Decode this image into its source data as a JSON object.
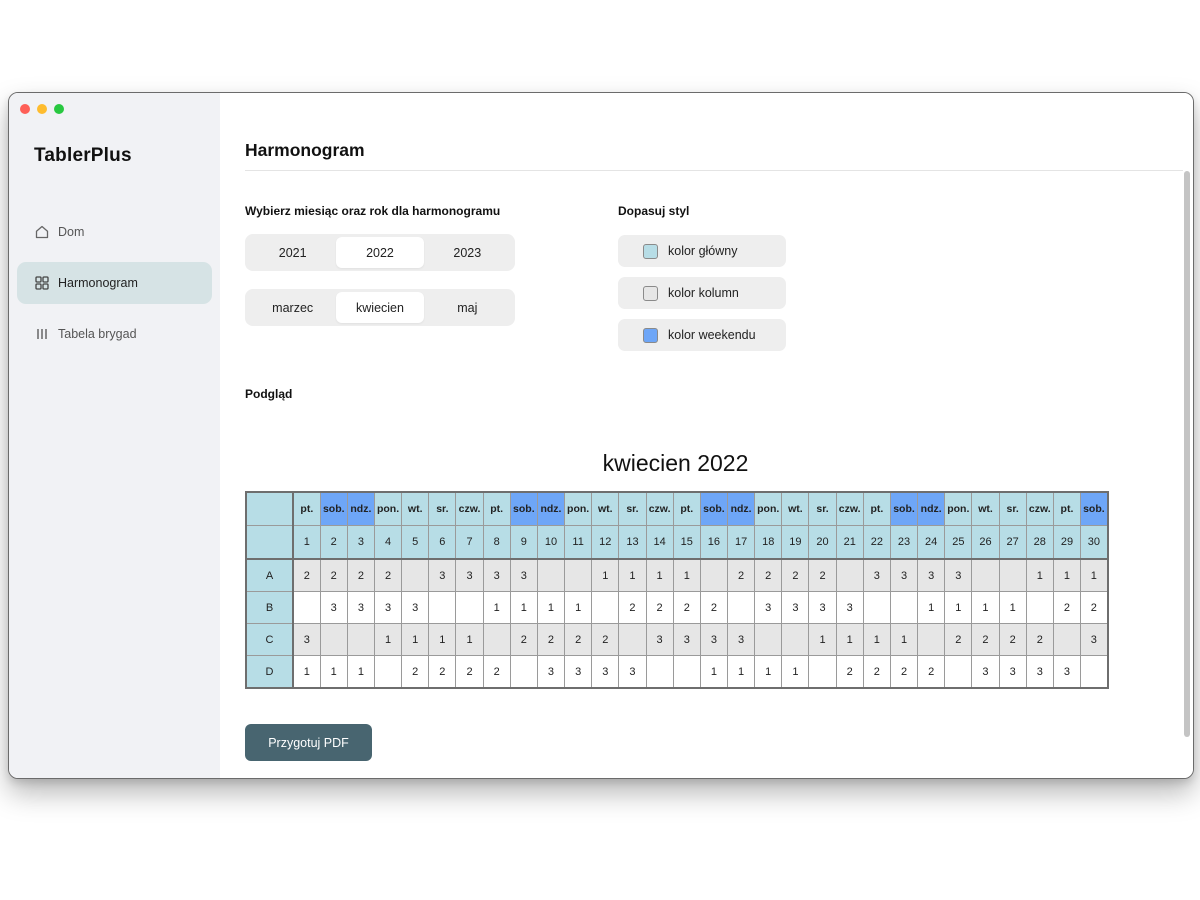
{
  "app": {
    "title": "TablerPlus"
  },
  "sidebar": {
    "items": [
      {
        "label": "Dom",
        "icon": "home-icon",
        "active": false
      },
      {
        "label": "Harmonogram",
        "icon": "grid-icon",
        "active": true
      },
      {
        "label": "Tabela brygad",
        "icon": "columns-icon",
        "active": false
      }
    ]
  },
  "page": {
    "title": "Harmonogram"
  },
  "selector": {
    "label": "Wybierz miesiąc oraz rok dla harmonogramu",
    "years": [
      "2021",
      "2022",
      "2023"
    ],
    "selected_year": "2022",
    "months": [
      "marzec",
      "kwiecien",
      "maj"
    ],
    "selected_month": "kwiecien"
  },
  "style": {
    "label": "Dopasuj styl",
    "options": [
      {
        "label": "kolor główny",
        "color": "#b7dde6"
      },
      {
        "label": "kolor kolumn",
        "color": "#e6e6e6"
      },
      {
        "label": "kolor weekendu",
        "color": "#6ea6f7"
      }
    ]
  },
  "preview": {
    "label": "Podgląd",
    "title": "kwiecien 2022"
  },
  "schedule": {
    "days": [
      "pt.",
      "sob.",
      "ndz.",
      "pon.",
      "wt.",
      "sr.",
      "czw.",
      "pt.",
      "sob.",
      "ndz.",
      "pon.",
      "wt.",
      "sr.",
      "czw.",
      "pt.",
      "sob.",
      "ndz.",
      "pon.",
      "wt.",
      "sr.",
      "czw.",
      "pt.",
      "sob.",
      "ndz.",
      "pon.",
      "wt.",
      "sr.",
      "czw.",
      "pt.",
      "sob."
    ],
    "dates": [
      "1",
      "2",
      "3",
      "4",
      "5",
      "6",
      "7",
      "8",
      "9",
      "10",
      "11",
      "12",
      "13",
      "14",
      "15",
      "16",
      "17",
      "18",
      "19",
      "20",
      "21",
      "22",
      "23",
      "24",
      "25",
      "26",
      "27",
      "28",
      "29",
      "30"
    ],
    "weekend_days": [
      "sob.",
      "ndz."
    ],
    "brigades": [
      {
        "name": "A",
        "values": [
          "2",
          "2",
          "2",
          "2",
          "",
          "3",
          "3",
          "3",
          "3",
          "",
          "",
          "1",
          "1",
          "1",
          "1",
          "",
          "2",
          "2",
          "2",
          "2",
          "",
          "3",
          "3",
          "3",
          "3",
          "",
          "",
          "1",
          "1",
          "1"
        ]
      },
      {
        "name": "B",
        "values": [
          "",
          "3",
          "3",
          "3",
          "3",
          "",
          "",
          "1",
          "1",
          "1",
          "1",
          "",
          "2",
          "2",
          "2",
          "2",
          "",
          "3",
          "3",
          "3",
          "3",
          "",
          "",
          "1",
          "1",
          "1",
          "1",
          "",
          "2",
          "2"
        ]
      },
      {
        "name": "C",
        "values": [
          "3",
          "",
          "",
          "1",
          "1",
          "1",
          "1",
          "",
          "2",
          "2",
          "2",
          "2",
          "",
          "3",
          "3",
          "3",
          "3",
          "",
          "",
          "1",
          "1",
          "1",
          "1",
          "",
          "2",
          "2",
          "2",
          "2",
          "",
          "3"
        ]
      },
      {
        "name": "D",
        "values": [
          "1",
          "1",
          "1",
          "",
          "2",
          "2",
          "2",
          "2",
          "",
          "3",
          "3",
          "3",
          "3",
          "",
          "",
          "1",
          "1",
          "1",
          "1",
          "",
          "2",
          "2",
          "2",
          "2",
          "",
          "3",
          "3",
          "3",
          "3",
          ""
        ]
      }
    ]
  },
  "actions": {
    "pdf_label": "Przygotuj PDF"
  }
}
